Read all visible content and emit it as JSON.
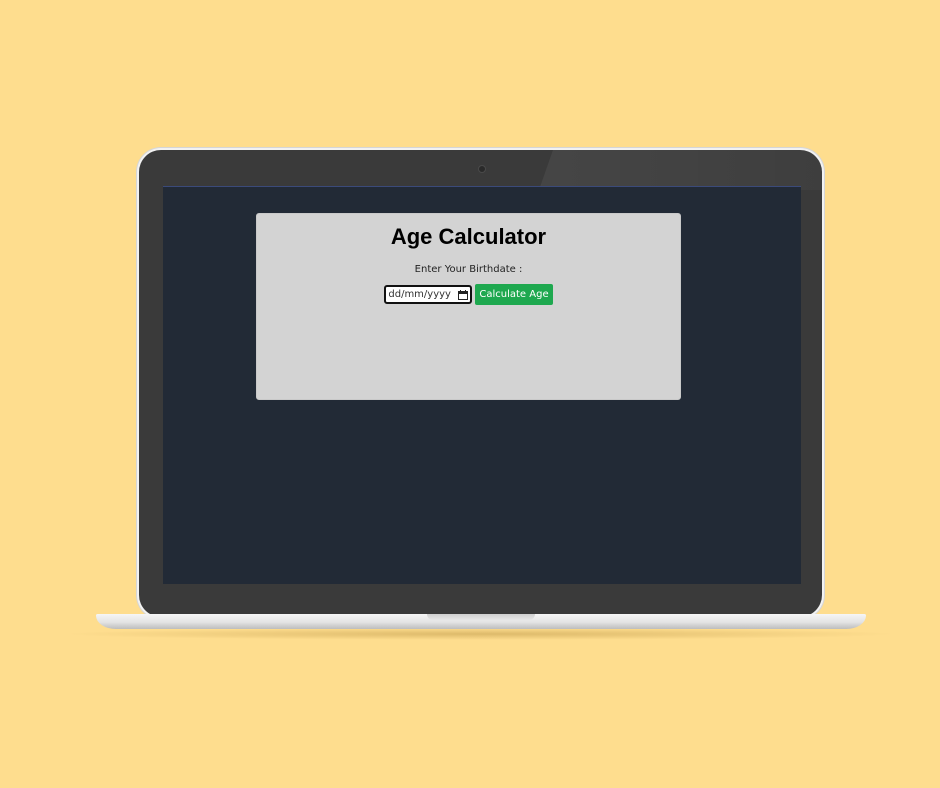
{
  "app": {
    "title": "Age Calculator",
    "prompt_label": "Enter Your Birthdate :",
    "date_input": {
      "placeholder": "dd/mm/yyyy",
      "value": "",
      "icon": "calendar-icon"
    },
    "calculate_button_label": "Calculate Age",
    "colors": {
      "page_background": "#fedd8e",
      "screen_background": "#222a36",
      "card_background": "#d3d3d3",
      "button_background": "#1ea84f",
      "button_text": "#ffffff"
    }
  }
}
